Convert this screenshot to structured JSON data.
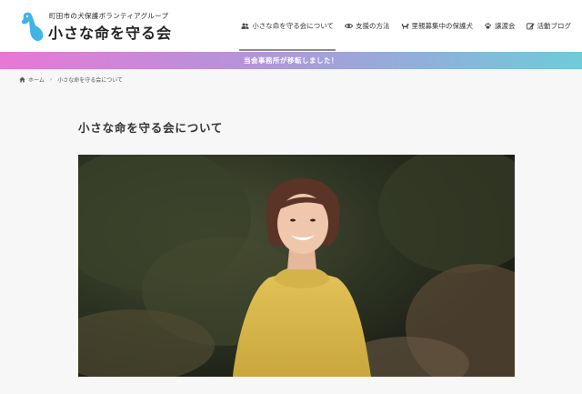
{
  "site": {
    "tagline": "町田市の犬保護ボランティアグループ",
    "name": "小さな命を守る会"
  },
  "nav": {
    "items": [
      {
        "label": "小さな命を守る会について",
        "icon": "users-icon"
      },
      {
        "label": "支援の方法",
        "icon": "eye-icon"
      },
      {
        "label": "里親募集中の保護犬",
        "icon": "dog-icon"
      },
      {
        "label": "譲渡会",
        "icon": "paw-icon"
      },
      {
        "label": "活動ブログ",
        "icon": "edit-icon"
      }
    ]
  },
  "notice": {
    "text": "当会事務所が移転しました！"
  },
  "breadcrumb": {
    "home": "ホーム",
    "current": "小さな命を守る会について"
  },
  "page": {
    "title": "小さな命を守る会について"
  },
  "colors": {
    "notice_start": "#e878d6",
    "notice_mid": "#b196d9",
    "notice_end": "#6ecbd9",
    "logo_accent": "#3fb4e5",
    "sweater": "#d9b94a"
  }
}
